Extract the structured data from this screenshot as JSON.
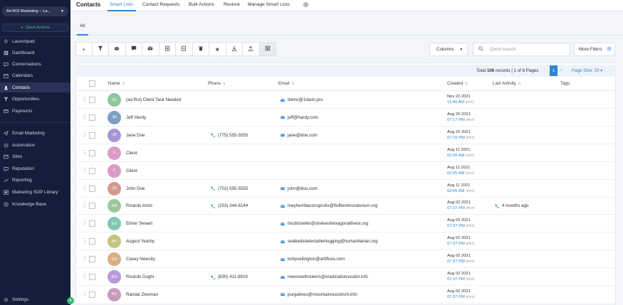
{
  "sidebar": {
    "account": "Ad ROI Marketing -- La...",
    "quick_actions": "Quick Actions",
    "items": [
      {
        "label": "Launchpad",
        "icon": "rocket-icon"
      },
      {
        "label": "Dashboard",
        "icon": "dashboard-icon"
      },
      {
        "label": "Conversations",
        "icon": "chat-icon"
      },
      {
        "label": "Calendars",
        "icon": "calendar-icon"
      },
      {
        "label": "Contacts",
        "icon": "contacts-icon"
      },
      {
        "label": "Opportunities",
        "icon": "funnel-icon"
      },
      {
        "label": "Payments",
        "icon": "payments-icon"
      },
      {
        "label": "Email Marketing",
        "icon": "send-icon"
      },
      {
        "label": "Automation",
        "icon": "automation-icon"
      },
      {
        "label": "Sites",
        "icon": "sites-icon"
      },
      {
        "label": "Reputation",
        "icon": "reputation-icon"
      },
      {
        "label": "Reporting",
        "icon": "reporting-icon"
      },
      {
        "label": "Marketing SOP Library",
        "icon": "library-icon"
      },
      {
        "label": "Knowledge Base",
        "icon": "knowledge-icon"
      }
    ],
    "settings": "Settings"
  },
  "topnav": {
    "title": "Contacts",
    "tabs": [
      "Smart Lists",
      "Contact Requests",
      "Bulk Actions",
      "Restore",
      "Manage Smart Lists"
    ]
  },
  "subtabs": {
    "all": "All"
  },
  "toolbar": {
    "columns": "Columns",
    "search_placeholder": "Quick search",
    "more_filters": "More Filters"
  },
  "pager": {
    "total_label": "Total",
    "total": "106",
    "records_suffix": "records |",
    "page_info": "1 of 6 Pages",
    "current_page": "1",
    "page_size": "Page Size: 20"
  },
  "table": {
    "headers": {
      "name": "Name",
      "phone": "Phone",
      "email": "Email",
      "created": "Created",
      "last_activity": "Last Activity",
      "tags": "Tags"
    },
    "rows": [
      {
        "initials": "JN",
        "color": "#8fc79f",
        "name": "(ad Roi) Client Task Needed",
        "phone": "",
        "email": "demo@1dash.pro",
        "date": "Nov 22 2021",
        "time": "11:40 AM",
        "tz": "(PST)",
        "activity": ""
      },
      {
        "initials": "JH",
        "color": "#7f9fc4",
        "name": "Jeff Hardy",
        "phone": "",
        "email": "jeff@hardy.com",
        "date": "Aug 20 2021",
        "time": "07:17 PM",
        "tz": "(PST)",
        "activity": ""
      },
      {
        "initials": "JD",
        "color": "#a597d4",
        "name": "Jane Doe",
        "phone": "(775) 555-5555",
        "email": "jane@doe.com",
        "date": "Aug 20 2021",
        "time": "07:16 PM",
        "tz": "(PST)",
        "activity": ""
      },
      {
        "initials": "C",
        "color": "#d99bc6",
        "name": "Client",
        "phone": "",
        "email": "",
        "date": "Aug 11 2021",
        "time": "02:06 AM",
        "tz": "(PST)",
        "activity": ""
      },
      {
        "initials": "C",
        "color": "#d99bc6",
        "name": "Client",
        "phone": "",
        "email": "",
        "date": "Aug 11 2021",
        "time": "02:05 AM",
        "tz": "(PST)",
        "activity": ""
      },
      {
        "initials": "JD",
        "color": "#d39a92",
        "name": "John Doe",
        "phone": "(702) 555-5555",
        "email": "john@doe.com",
        "date": "Aug 11 2021",
        "time": "02:05 AM",
        "tz": "(PST)",
        "activity": ""
      },
      {
        "initials": "RA",
        "color": "#9dc79a",
        "name": "Ricardo Antol",
        "phone": "(253) 344-8144",
        "email": "mayhembaconsprolix@fluffiestmoratorium.org",
        "date": "Aug 02 2021",
        "time": "07:37 PM",
        "tz": "(PST)",
        "activity": "4 months ago"
      },
      {
        "initials": "ES",
        "color": "#7fc7b6",
        "name": "Elmer Sewart",
        "phone": "",
        "email": "foodslowlier@shelveshexagonallivest.org",
        "date": "Aug 02 2021",
        "time": "07:37 PM",
        "tz": "(PST)",
        "activity": ""
      },
      {
        "initials": "AY",
        "color": "#c7c37e",
        "name": "August Yearby",
        "phone": "",
        "email": "seabedsdelectablehugging@humanitarian.org",
        "date": "Aug 02 2021",
        "time": "07:37 PM",
        "tz": "(PST)",
        "activity": ""
      },
      {
        "initials": "CN",
        "color": "#d8b07f",
        "name": "Casey Newcity",
        "phone": "",
        "email": "kirbysellington@artifices.com",
        "date": "Aug 02 2021",
        "time": "07:37 PM",
        "tz": "(PST)",
        "activity": ""
      },
      {
        "initials": "RD",
        "color": "#b79ad8",
        "name": "Ricardo Dughi",
        "phone": "(830) 411-8919",
        "email": "newsreelhookers@eradicationssuitor.info",
        "date": "Aug 02 2021",
        "time": "07:37 PM",
        "tz": "(PST)",
        "activity": ""
      },
      {
        "initials": "RZ",
        "color": "#c79ac0",
        "name": "Randal Ziesman",
        "phone": "",
        "email": "purgatives@mountainousclinch.info",
        "date": "Aug 02 2021",
        "time": "07:37 PM",
        "tz": "(PST)",
        "activity": ""
      }
    ]
  },
  "colors": {
    "accent": "#2b86d8",
    "sidebar": "#141d3a",
    "quick_action": "#4fc08d"
  }
}
